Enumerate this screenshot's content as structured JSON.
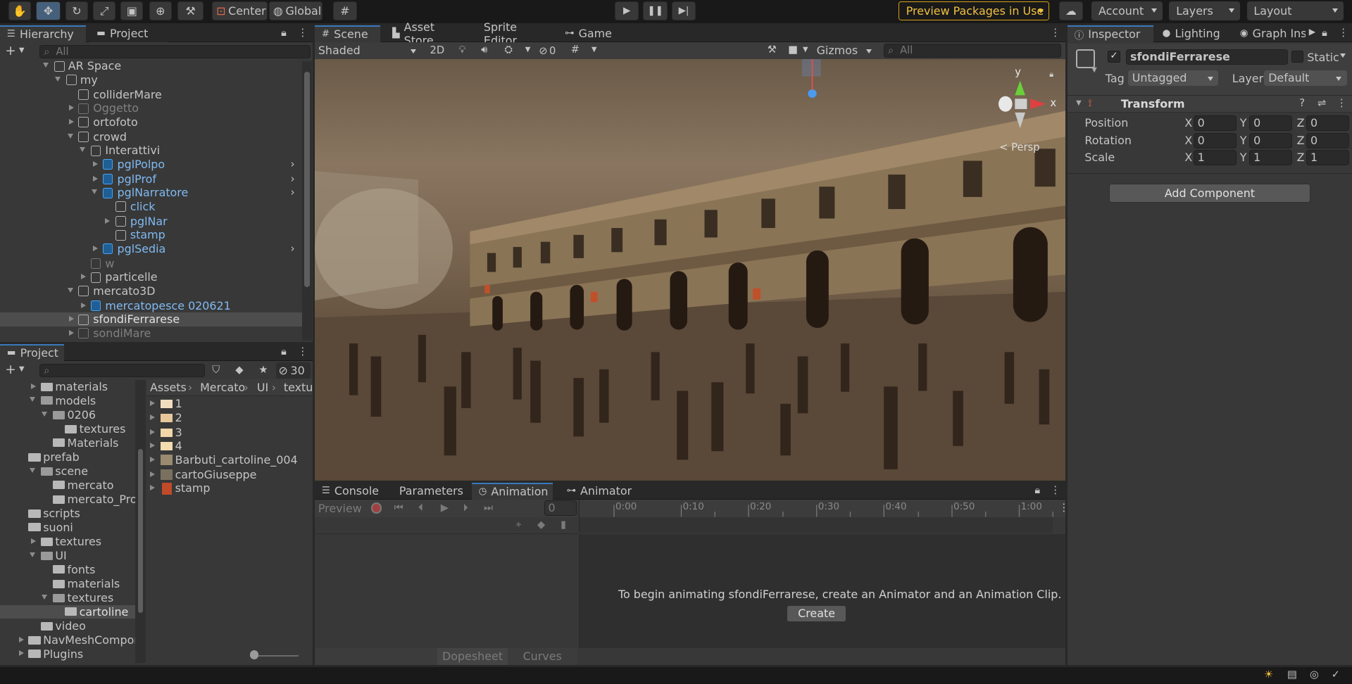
{
  "toolbar": {
    "pivot_label": "Center",
    "space_label": "Global",
    "preview_packages": "Preview Packages in Use",
    "account": "Account",
    "layers": "Layers",
    "layout": "Layout"
  },
  "hierarchy": {
    "tab": "Hierarchy",
    "tab2": "Project",
    "search_placeholder": "All",
    "items": [
      {
        "label": "AR Space"
      },
      {
        "label": "my"
      },
      {
        "label": "colliderMare"
      },
      {
        "label": "Oggetto"
      },
      {
        "label": "ortofoto"
      },
      {
        "label": "crowd"
      },
      {
        "label": "Interattivi"
      },
      {
        "label": "pglPolpo"
      },
      {
        "label": "pglProf"
      },
      {
        "label": "pglNarratore"
      },
      {
        "label": "click"
      },
      {
        "label": "pglNar"
      },
      {
        "label": "stamp"
      },
      {
        "label": "pglSedia"
      },
      {
        "label": "w"
      },
      {
        "label": "particelle"
      },
      {
        "label": "mercato3D"
      },
      {
        "label": "mercatopesce 020621"
      },
      {
        "label": "sfondiFerrarese"
      },
      {
        "label": "sondiMare"
      }
    ]
  },
  "project": {
    "tab": "Project",
    "hidden_count": "30",
    "folders": [
      {
        "label": "materials"
      },
      {
        "label": "models"
      },
      {
        "label": "0206"
      },
      {
        "label": "textures"
      },
      {
        "label": "Materials"
      },
      {
        "label": "prefab"
      },
      {
        "label": "scene"
      },
      {
        "label": "mercato"
      },
      {
        "label": "mercato_Prof"
      },
      {
        "label": "scripts"
      },
      {
        "label": "suoni"
      },
      {
        "label": "textures"
      },
      {
        "label": "UI"
      },
      {
        "label": "fonts"
      },
      {
        "label": "materials"
      },
      {
        "label": "textures"
      },
      {
        "label": "cartoline"
      },
      {
        "label": "video"
      },
      {
        "label": "NavMeshCompon"
      },
      {
        "label": "Plugins"
      }
    ],
    "breadcrumb": [
      "Assets",
      "Mercato",
      "UI",
      "textur"
    ],
    "files": [
      {
        "label": "1"
      },
      {
        "label": "2"
      },
      {
        "label": "3"
      },
      {
        "label": "4"
      },
      {
        "label": "Barbuti_cartoline_004"
      },
      {
        "label": "cartoGiuseppe"
      },
      {
        "label": "stamp"
      }
    ]
  },
  "scene": {
    "tabs": [
      "Scene",
      "Asset Store",
      "Sprite Editor",
      "Game"
    ],
    "shading": "Shaded",
    "mode_2d": "2D",
    "hidden_count": "0",
    "gizmos": "Gizmos",
    "search_placeholder": "All",
    "persp": "< Persp",
    "axis_y": "y",
    "axis_x": "x"
  },
  "animation": {
    "tabs": [
      "Console",
      "Parameters",
      "Animation",
      "Animator"
    ],
    "preview": "Preview",
    "frame": "0",
    "ticks": [
      "0:00",
      "0:10",
      "0:20",
      "0:30",
      "0:40",
      "0:50",
      "1:00"
    ],
    "message": "To begin animating sfondiFerrarese, create an Animator and an Animation Clip.",
    "create": "Create",
    "dopesheet": "Dopesheet",
    "curves": "Curves"
  },
  "inspector": {
    "tabs": [
      "Inspector",
      "Lighting",
      "Graph Insp"
    ],
    "object_name": "sfondiFerrarese",
    "static": "Static",
    "tag_label": "Tag",
    "tag_value": "Untagged",
    "layer_label": "Layer",
    "layer_value": "Default",
    "component": "Transform",
    "position": {
      "label": "Position",
      "x": "0",
      "y": "0",
      "z": "0"
    },
    "rotation": {
      "label": "Rotation",
      "x": "0",
      "y": "0",
      "z": "0"
    },
    "scale": {
      "label": "Scale",
      "x": "1",
      "y": "1",
      "z": "1"
    },
    "add_component": "Add Component"
  }
}
